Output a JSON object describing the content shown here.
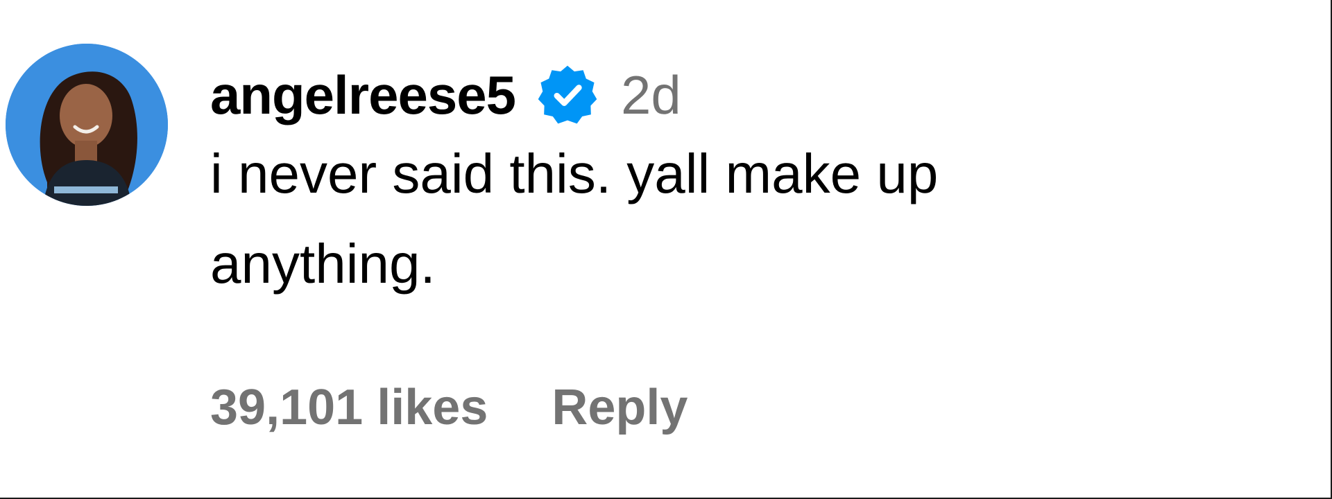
{
  "comment": {
    "username": "angelreese5",
    "verified": true,
    "time_ago": "2d",
    "text": "i never said this. yall make up anything.",
    "likes_label": "39,101 likes",
    "reply_label": "Reply"
  },
  "icons": {
    "verified_badge": "verified-badge-icon",
    "avatar": "profile-avatar"
  },
  "colors": {
    "verified_blue": "#0095f6",
    "secondary_text": "#737373",
    "avatar_bg": "#3b8fe0"
  }
}
